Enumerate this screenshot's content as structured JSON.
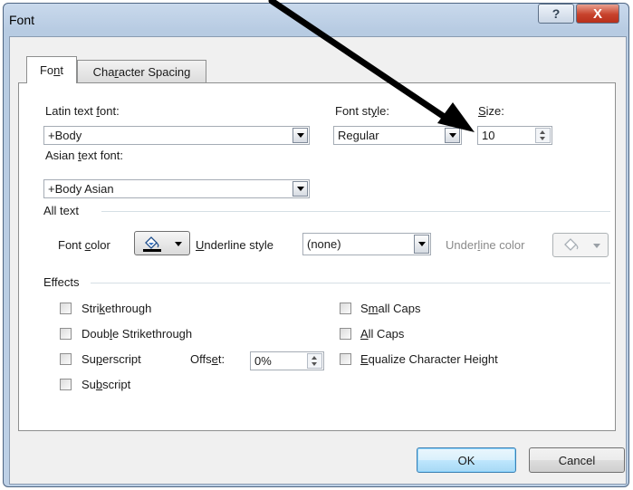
{
  "window": {
    "title": "Font",
    "help_glyph": "?",
    "close_glyph": "X"
  },
  "tabs": [
    {
      "label_pre": "Fo",
      "label_key": "n",
      "label_post": "t",
      "active": true
    },
    {
      "label_pre": "Cha",
      "label_key": "r",
      "label_post": "acter Spacing",
      "active": false
    }
  ],
  "latin_font": {
    "label_pre": "Latin text ",
    "label_key": "f",
    "label_post": "ont:",
    "value": "+Body"
  },
  "font_style": {
    "label_pre": "Font st",
    "label_key": "y",
    "label_post": "le:",
    "value": "Regular"
  },
  "size": {
    "label_pre": "",
    "label_key": "S",
    "label_post": "ize:",
    "value": "10"
  },
  "asian_font": {
    "label_pre": "Asian ",
    "label_key": "t",
    "label_post": "ext font:",
    "value": "+Body Asian"
  },
  "all_text": {
    "heading": "All text",
    "font_color": {
      "label_pre": "Font ",
      "label_key": "c",
      "label_post": "olor"
    },
    "underline_style": {
      "label_pre": "",
      "label_key": "U",
      "label_post": "nderline style",
      "value": "(none)"
    },
    "underline_color": {
      "label_pre": "Under",
      "label_key": "l",
      "label_post": "ine color"
    }
  },
  "effects": {
    "heading": "Effects",
    "strikethrough": {
      "pre": "Stri",
      "key": "k",
      "post": "ethrough",
      "checked": false
    },
    "double_strikethrough": {
      "pre": "Doub",
      "key": "l",
      "post": "e Strikethrough",
      "checked": false
    },
    "superscript": {
      "pre": "Su",
      "key": "p",
      "post": "erscript",
      "checked": false
    },
    "subscript": {
      "pre": "Su",
      "key": "b",
      "post": "script",
      "checked": false
    },
    "offset": {
      "label_pre": "Offs",
      "label_key": "e",
      "label_post": "t:",
      "value": "0%"
    },
    "small_caps": {
      "pre": "S",
      "key": "m",
      "post": "all Caps",
      "checked": false
    },
    "all_caps": {
      "pre": "",
      "key": "A",
      "post": "ll Caps",
      "checked": false
    },
    "equalize": {
      "pre": "",
      "key": "E",
      "post": "qualize Character Height",
      "checked": false
    }
  },
  "buttons": {
    "ok": "OK",
    "cancel": "Cancel"
  },
  "colors": {
    "font_color_swatch": "#000000",
    "arrow": "#000000",
    "title_bar": "#bdd0e6"
  },
  "annotation": {
    "type": "arrow",
    "points_to": "size-input"
  }
}
